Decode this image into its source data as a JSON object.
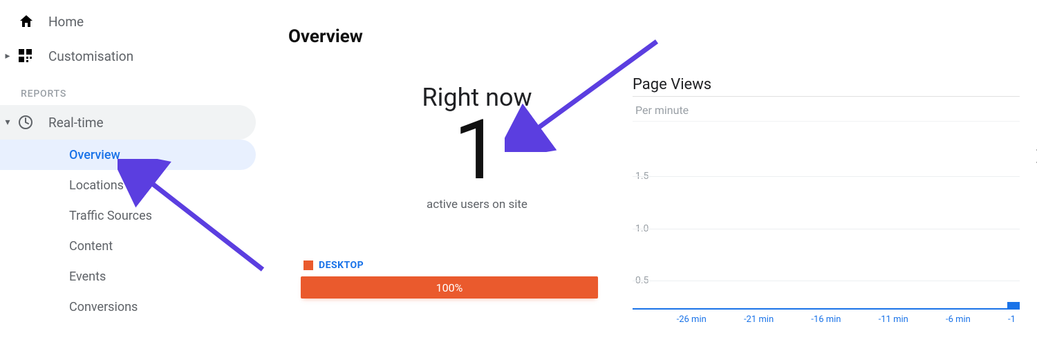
{
  "sidebar": {
    "home": "Home",
    "customisation": "Customisation",
    "section_reports": "REPORTS",
    "realtime": {
      "label": "Real-time",
      "items": [
        "Overview",
        "Locations",
        "Traffic Sources",
        "Content",
        "Events",
        "Conversions"
      ],
      "active_index": 0
    }
  },
  "main": {
    "title": "Overview",
    "right_now_label": "Right now",
    "active_users_count": "1",
    "active_users_caption": "active users on site",
    "breakdown": {
      "legend_label": "DESKTOP",
      "percent_label": "100%",
      "color": "#ea5a2d"
    }
  },
  "chart_data": {
    "type": "bar",
    "title": "Page Views",
    "subtitle": "Per minute",
    "ylim": [
      0,
      2
    ],
    "y_ticks": [
      "0.5",
      "1.0",
      "1.5"
    ],
    "x_labels": [
      "-26 min",
      "-21 min",
      "-16 min",
      "-11 min",
      "-6 min",
      "-1"
    ],
    "series": [
      {
        "name": "pageviews_per_minute",
        "values": [
          0,
          0,
          0,
          0,
          0,
          0,
          0,
          0,
          0,
          0,
          0,
          0,
          0,
          0,
          0,
          0,
          0,
          0,
          0,
          0,
          0,
          0,
          0,
          0,
          0,
          0,
          0,
          0,
          0,
          0,
          1
        ]
      }
    ]
  }
}
